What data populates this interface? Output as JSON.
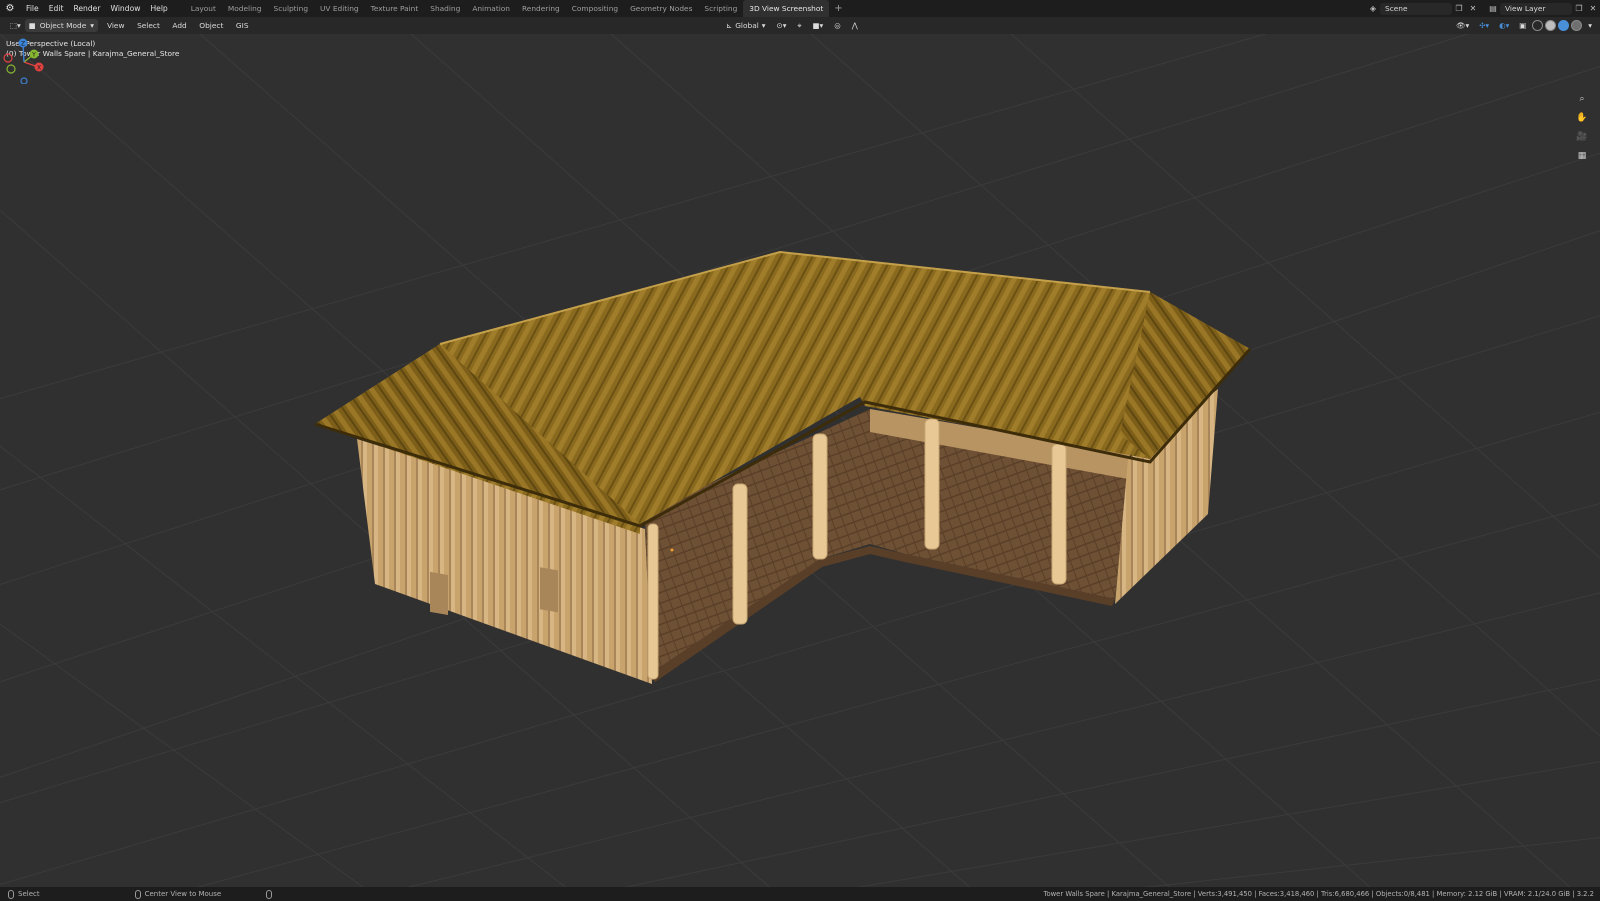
{
  "menu": {
    "file": "File",
    "edit": "Edit",
    "render": "Render",
    "window": "Window",
    "help": "Help"
  },
  "workspaces": [
    "Layout",
    "Modeling",
    "Sculpting",
    "UV Editing",
    "Texture Paint",
    "Shading",
    "Animation",
    "Rendering",
    "Compositing",
    "Geometry Nodes",
    "Scripting",
    "3D View Screenshot"
  ],
  "active_workspace": "3D View Screenshot",
  "scene": {
    "label": "Scene"
  },
  "view_layer": {
    "label": "View Layer"
  },
  "viewport_header": {
    "mode": "Object Mode",
    "menus": {
      "view": "View",
      "select": "Select",
      "add": "Add",
      "object": "Object",
      "gis": "GIS"
    },
    "orientation": "Global"
  },
  "viewport": {
    "perspective": "User Perspective (Local)",
    "collection": "(0) Tower Walls Spare | Karajma_General_Store"
  },
  "gizmo": {
    "x": "X",
    "y": "Y",
    "z": "Z"
  },
  "status": {
    "select": "Select",
    "center": "Center View to Mouse",
    "stats": "Tower Walls Spare | Karajma_General_Store | Verts:3,491,450 | Faces:3,418,460 | Tris:6,680,466 | Objects:0/8,481 | Memory: 2.12 GiB | VRAM: 2.1/24.0 GiB | 3.2.2"
  },
  "colors": {
    "x_axis": "#e0423f",
    "y_axis": "#86b530",
    "z_axis": "#3b83d6",
    "background": "#303030",
    "roof": "#8a6b1e",
    "walls": "#c9a470"
  }
}
